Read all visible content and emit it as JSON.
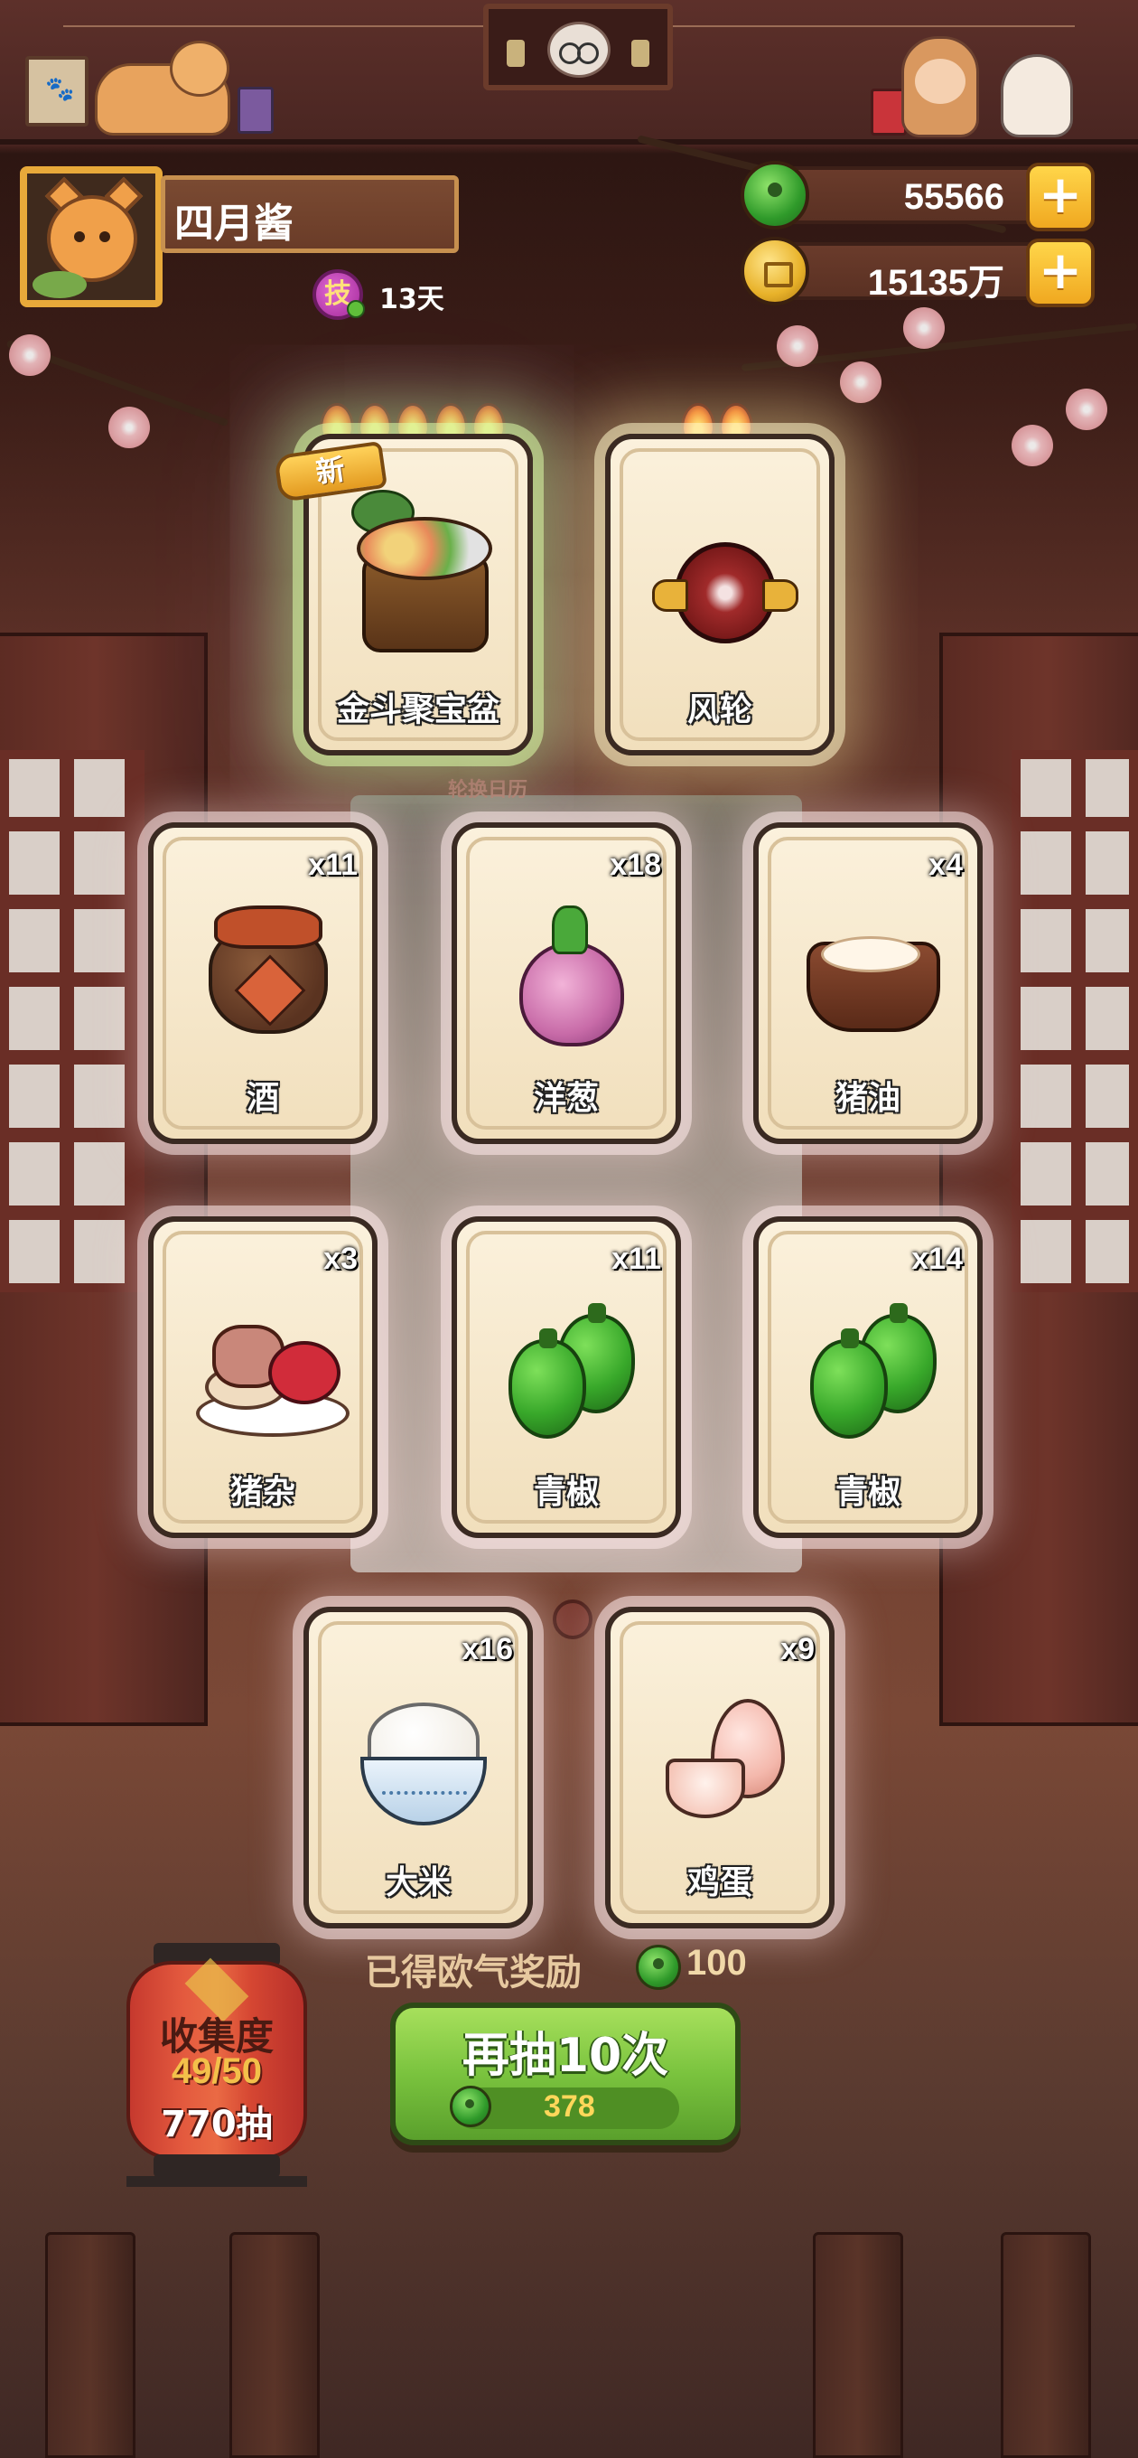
{
  "player": {
    "name": "四月酱",
    "skill_icon_text": "技",
    "days": "13天"
  },
  "currency": {
    "jade_value": "55566",
    "coin_value": "15135万",
    "plus_symbol": "+"
  },
  "featured_cards": [
    {
      "name": "金斗聚宝盆",
      "tag": "新",
      "flames": 5
    },
    {
      "name": "风轮",
      "flames": 2
    }
  ],
  "rotate_label": "轮换日历",
  "cards": [
    {
      "name": "酒",
      "count": "x11"
    },
    {
      "name": "洋葱",
      "count": "x18"
    },
    {
      "name": "猪油",
      "count": "x4"
    },
    {
      "name": "猪杂",
      "count": "x3"
    },
    {
      "name": "青椒",
      "count": "x11"
    },
    {
      "name": "青椒",
      "count": "x14"
    },
    {
      "name": "大米",
      "count": "x16"
    },
    {
      "name": "鸡蛋",
      "count": "x9"
    }
  ],
  "reward": {
    "label": "已得欧气奖励",
    "value": "100"
  },
  "draw_button": {
    "label": "再抽10次",
    "cost": "378"
  },
  "collection": {
    "title": "收集度",
    "progress": "49/50",
    "draws": "770抽"
  }
}
